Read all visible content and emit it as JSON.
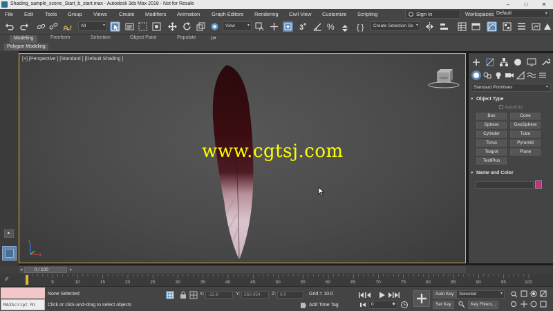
{
  "window": {
    "title": "Shading_sample_scene_Start_b_start.max - Autodesk 3ds Max 2018  - Not for Resale",
    "controls": [
      "–",
      "□",
      "✕"
    ]
  },
  "menu": {
    "items": [
      "File",
      "Edit",
      "Tools",
      "Group",
      "Views",
      "Create",
      "Modifiers",
      "Animation",
      "Graph Editors",
      "Rendering",
      "Civil View",
      "Customize",
      "Scripting"
    ],
    "sign_in": "Sign In",
    "workspaces_label": "Workspaces:",
    "workspace_value": "Default"
  },
  "toolbar": {
    "selection_filter": "All",
    "reference_coord": "View",
    "named_selection": "Create Selection Se",
    "icons": [
      "undo-icon",
      "redo-icon",
      "link-icon",
      "unlink-icon",
      "bind-spacewarp-icon",
      "select-object-icon",
      "select-by-name-icon",
      "rect-region-icon",
      "window-crossing-icon",
      "move-icon",
      "rotate-icon",
      "scale-icon",
      "placement-icon",
      "pivot-icon",
      "manipulate-icon",
      "keyboard-shortcut-icon",
      "snap-3d-icon",
      "angle-snap-icon",
      "percent-snap-icon",
      "spinner-snap-icon",
      "edit-named-selection-icon",
      "mirror-icon",
      "align-icon",
      "layer-explorer-icon",
      "ribbon-toggle-icon",
      "curve-editor-icon",
      "schematic-view-icon",
      "material-editor-icon",
      "render-setup-icon",
      "rendered-frame-icon",
      "render-icon"
    ]
  },
  "ribbon": {
    "tabs": [
      "Modeling",
      "Freeform",
      "Selection",
      "Object Paint",
      "Populate"
    ],
    "active_tab": "Modeling",
    "subpanel": "Polygon Modeling"
  },
  "viewport": {
    "label": "[+] [Perspective ] [Standard ] [Default Shading ]",
    "watermark": "www.cgtsj.com",
    "viewcube_label": "FRONT"
  },
  "command_panel": {
    "tabs": [
      "create-tab",
      "modify-tab",
      "hierarchy-tab",
      "motion-tab",
      "display-tab",
      "utilities-tab"
    ],
    "category_dropdown": "Standard Primitives",
    "object_type_title": "Object Type",
    "autogrid_label": "AutoGrid",
    "primitives": [
      "Box",
      "Cone",
      "Sphere",
      "GeoSphere",
      "Cylinder",
      "Tube",
      "Torus",
      "Pyramid",
      "Teapot",
      "Plane",
      "TextPlus"
    ],
    "name_color_title": "Name and Color",
    "object_color": "#c4307f"
  },
  "time_slider": {
    "value": "0 / 100",
    "ticks": [
      "0",
      "5",
      "10",
      "15",
      "20",
      "25",
      "30",
      "35",
      "40",
      "45",
      "50",
      "55",
      "60",
      "65",
      "70",
      "75",
      "80",
      "85",
      "90",
      "95",
      "100"
    ]
  },
  "status": {
    "selection": "None Selected",
    "prompt": "Click or click-and-drag to select objects",
    "maxscript_label": "MAXScript Mi",
    "x_label": "X:",
    "x_value": "-22.8",
    "y_label": "Y:",
    "y_value": "260.054",
    "z_label": "Z:",
    "z_value": "0.0",
    "grid": "Grid = 10.0",
    "add_time_tag": "Add Time Tag",
    "frame_value": "0",
    "auto_key": "Auto Key",
    "set_key": "Set Key",
    "key_mode": "Selected",
    "key_filters": "Key Filters..."
  },
  "colors": {
    "accent": "#5c87b2",
    "viewport_border": "#e2b43a",
    "watermark": "#ffff00",
    "maxscript_listener": "#f2c7c9"
  }
}
